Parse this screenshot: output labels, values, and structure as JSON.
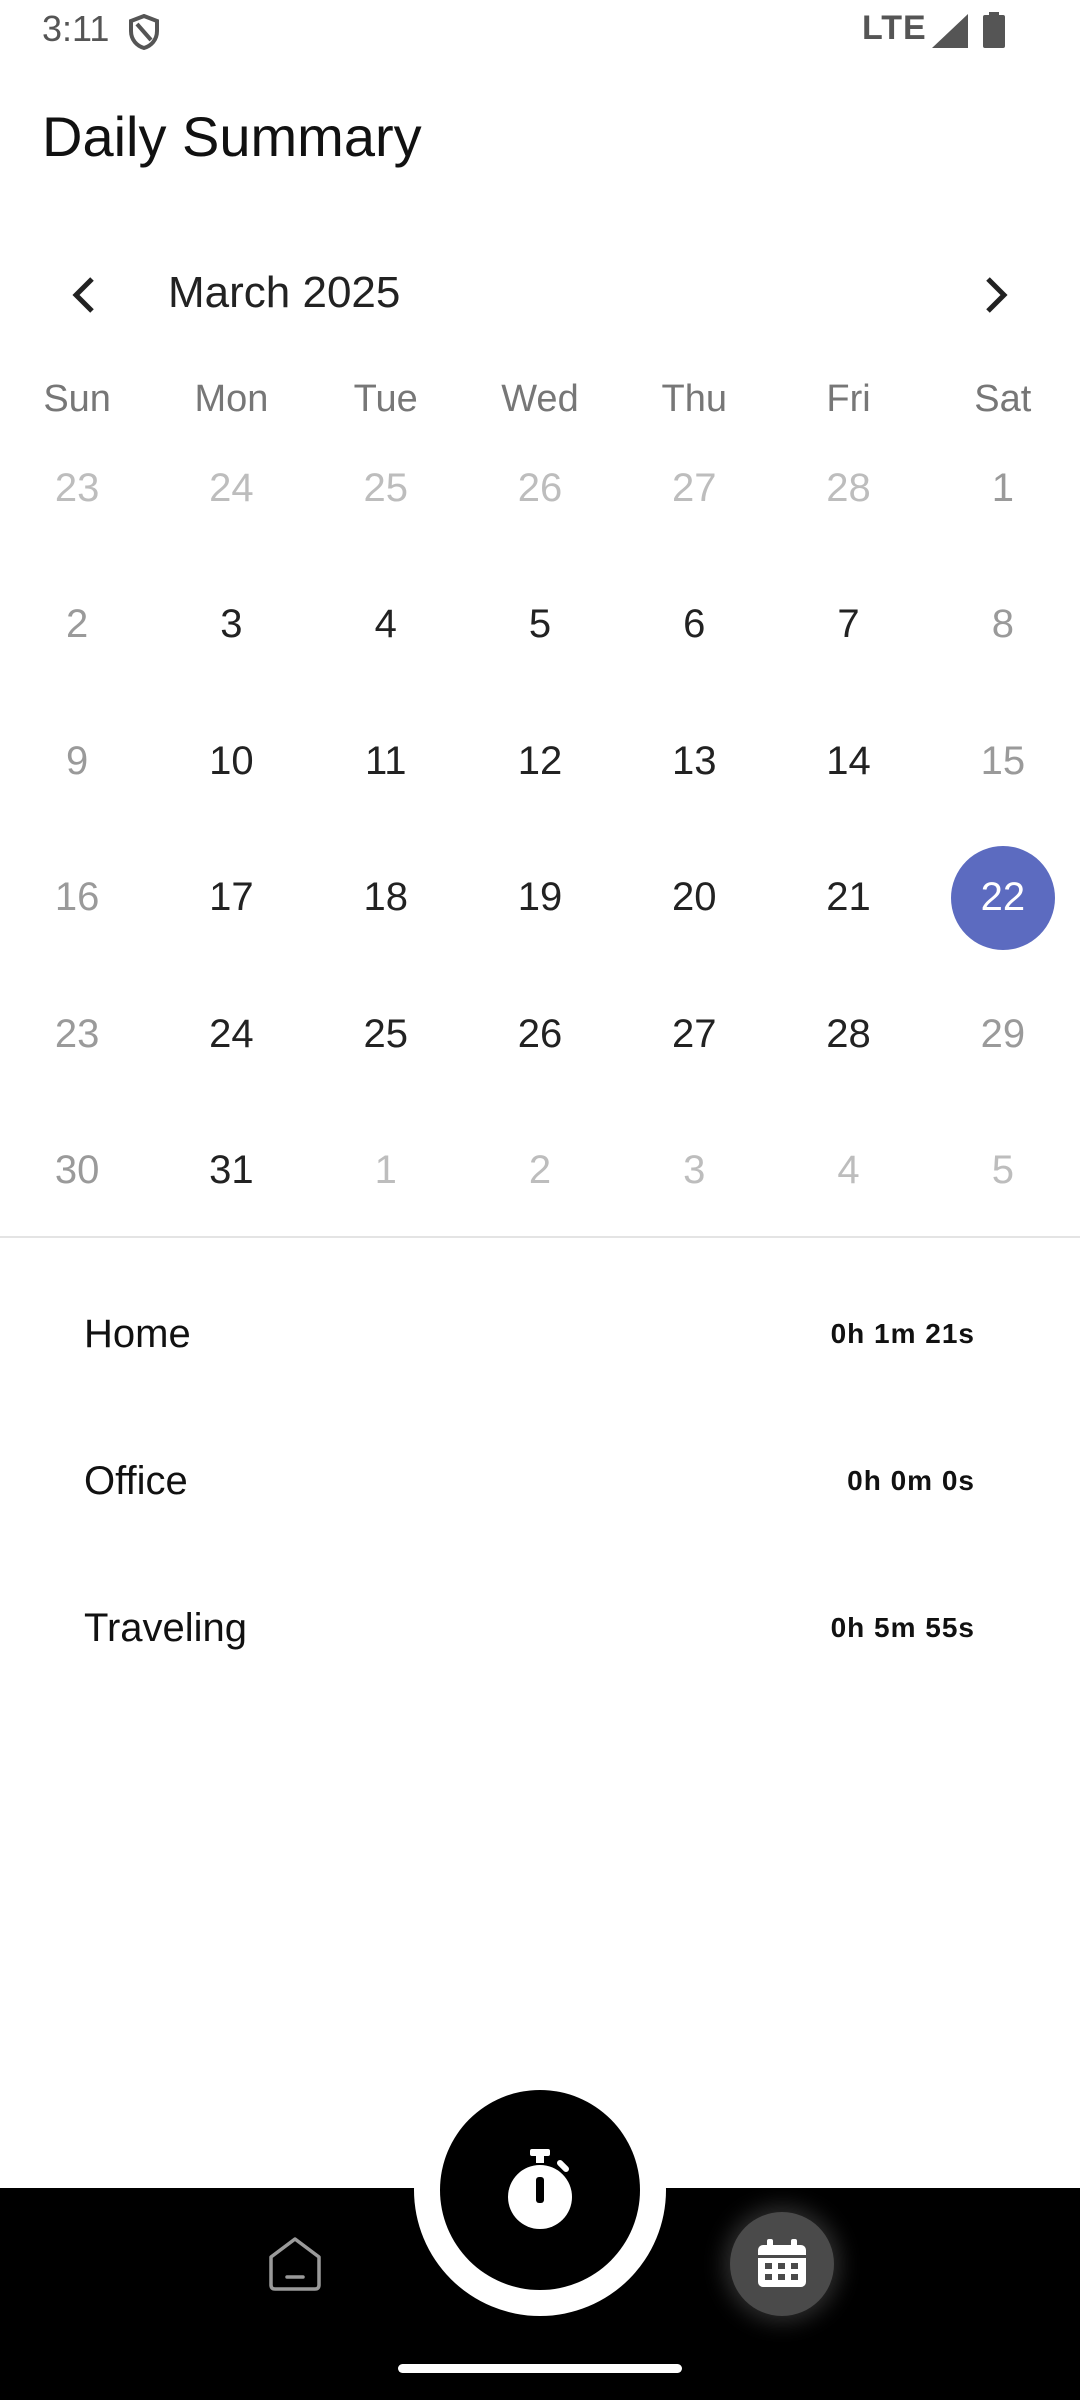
{
  "status_bar": {
    "time": "3:11",
    "network": "LTE",
    "icons": [
      "shield-icon",
      "signal-icon",
      "battery-icon"
    ]
  },
  "page": {
    "title": "Daily Summary"
  },
  "calendar": {
    "month_label": "March 2025",
    "weekdays": [
      "Sun",
      "Mon",
      "Tue",
      "Wed",
      "Thu",
      "Fri",
      "Sat"
    ],
    "weeks": [
      [
        {
          "label": "23",
          "style": "faded"
        },
        {
          "label": "24",
          "style": "faded"
        },
        {
          "label": "25",
          "style": "faded"
        },
        {
          "label": "26",
          "style": "faded"
        },
        {
          "label": "27",
          "style": "faded"
        },
        {
          "label": "28",
          "style": "faded"
        },
        {
          "label": "1",
          "style": "weekend"
        }
      ],
      [
        {
          "label": "2",
          "style": "weekend"
        },
        {
          "label": "3",
          "style": "normal"
        },
        {
          "label": "4",
          "style": "normal"
        },
        {
          "label": "5",
          "style": "normal"
        },
        {
          "label": "6",
          "style": "normal"
        },
        {
          "label": "7",
          "style": "normal"
        },
        {
          "label": "8",
          "style": "weekend"
        }
      ],
      [
        {
          "label": "9",
          "style": "weekend"
        },
        {
          "label": "10",
          "style": "normal"
        },
        {
          "label": "11",
          "style": "normal"
        },
        {
          "label": "12",
          "style": "normal"
        },
        {
          "label": "13",
          "style": "normal"
        },
        {
          "label": "14",
          "style": "normal"
        },
        {
          "label": "15",
          "style": "weekend"
        }
      ],
      [
        {
          "label": "16",
          "style": "weekend"
        },
        {
          "label": "17",
          "style": "normal"
        },
        {
          "label": "18",
          "style": "normal"
        },
        {
          "label": "19",
          "style": "normal"
        },
        {
          "label": "20",
          "style": "normal"
        },
        {
          "label": "21",
          "style": "normal"
        },
        {
          "label": "22",
          "style": "selected"
        }
      ],
      [
        {
          "label": "23",
          "style": "weekend"
        },
        {
          "label": "24",
          "style": "normal"
        },
        {
          "label": "25",
          "style": "normal"
        },
        {
          "label": "26",
          "style": "normal"
        },
        {
          "label": "27",
          "style": "normal"
        },
        {
          "label": "28",
          "style": "normal"
        },
        {
          "label": "29",
          "style": "weekend"
        }
      ],
      [
        {
          "label": "30",
          "style": "weekend"
        },
        {
          "label": "31",
          "style": "normal"
        },
        {
          "label": "1",
          "style": "faded"
        },
        {
          "label": "2",
          "style": "faded"
        },
        {
          "label": "3",
          "style": "faded"
        },
        {
          "label": "4",
          "style": "faded"
        },
        {
          "label": "5",
          "style": "faded"
        }
      ]
    ],
    "selected_color": "#5c6bc0"
  },
  "summary": {
    "items": [
      {
        "name": "Home",
        "time": "0h 1m 21s"
      },
      {
        "name": "Office",
        "time": "0h 0m 0s"
      },
      {
        "name": "Traveling",
        "time": "0h 5m 55s"
      }
    ]
  },
  "bottom_nav": {
    "items": [
      "home-icon",
      "stopwatch-icon",
      "calendar-icon"
    ],
    "active": "calendar-icon"
  }
}
